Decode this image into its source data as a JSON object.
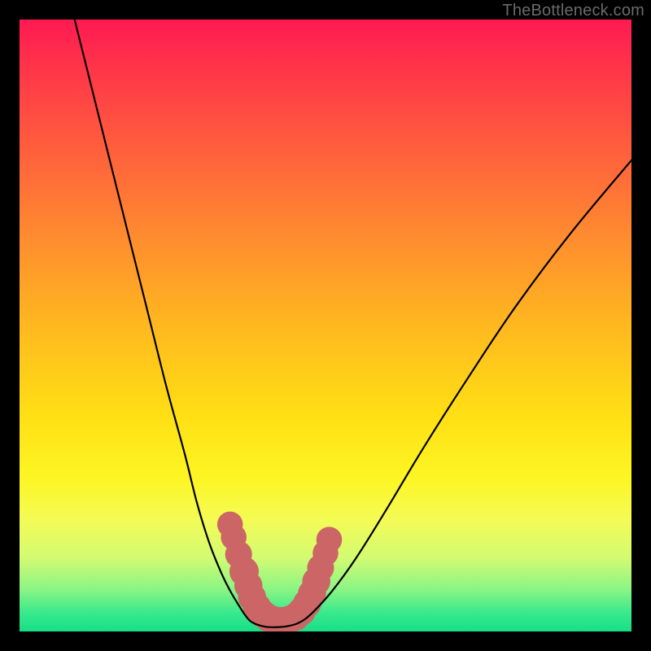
{
  "watermark": "TheBottleneck.com",
  "colors": {
    "page_bg": "#000000",
    "curve": "#000000",
    "markers": "#cc6666",
    "gradient_top": "#ff1a52",
    "gradient_mid": "#ffe014",
    "gradient_bottom": "#18de86"
  },
  "chart_data": {
    "type": "line",
    "title": "",
    "xlabel": "",
    "ylabel": "",
    "xlim": [
      0,
      100
    ],
    "ylim": [
      0,
      100
    ],
    "grid": false,
    "note": "V-shaped bottleneck curve on vertical red→green gradient. No tick labels or axis text shown; data values estimated from gridless image.",
    "series": [
      {
        "name": "left-branch",
        "x": [
          9,
          12,
          15,
          18,
          21,
          24,
          27,
          29,
          31,
          33,
          34.5,
          36,
          37,
          38
        ],
        "y": [
          100,
          88,
          76,
          64,
          52,
          40,
          29,
          21,
          14.5,
          9.5,
          6.5,
          4,
          2.5,
          1.5
        ]
      },
      {
        "name": "valley-floor",
        "x": [
          38,
          40,
          42,
          44,
          46
        ],
        "y": [
          1.5,
          0.8,
          0.7,
          0.9,
          1.6
        ]
      },
      {
        "name": "right-branch",
        "x": [
          46,
          48,
          51,
          55,
          60,
          66,
          73,
          81,
          90,
          100
        ],
        "y": [
          1.6,
          3.2,
          6.5,
          12,
          20,
          30,
          41,
          53,
          65,
          77
        ]
      }
    ],
    "markers": [
      {
        "x": 34.4,
        "y": 17.5,
        "r": 2.1
      },
      {
        "x": 35.0,
        "y": 15.4,
        "r": 2.1
      },
      {
        "x": 35.8,
        "y": 12.6,
        "r": 2.2
      },
      {
        "x": 36.7,
        "y": 9.8,
        "r": 2.4
      },
      {
        "x": 37.4,
        "y": 7.5,
        "r": 2.3
      },
      {
        "x": 38.0,
        "y": 5.6,
        "r": 2.3
      },
      {
        "x": 38.8,
        "y": 4.0,
        "r": 2.3
      },
      {
        "x": 39.7,
        "y": 2.9,
        "r": 2.3
      },
      {
        "x": 40.7,
        "y": 2.2,
        "r": 2.3
      },
      {
        "x": 41.8,
        "y": 1.8,
        "r": 2.3
      },
      {
        "x": 42.9,
        "y": 1.7,
        "r": 2.3
      },
      {
        "x": 44.0,
        "y": 1.9,
        "r": 2.3
      },
      {
        "x": 45.1,
        "y": 2.4,
        "r": 2.3
      },
      {
        "x": 46.1,
        "y": 3.3,
        "r": 2.3
      },
      {
        "x": 47.0,
        "y": 4.6,
        "r": 2.3
      },
      {
        "x": 47.8,
        "y": 6.2,
        "r": 2.3
      },
      {
        "x": 48.5,
        "y": 8.2,
        "r": 2.3
      },
      {
        "x": 49.2,
        "y": 10.4,
        "r": 2.2
      },
      {
        "x": 50.0,
        "y": 12.8,
        "r": 2.1
      },
      {
        "x": 50.6,
        "y": 15.0,
        "r": 2.1
      }
    ]
  }
}
